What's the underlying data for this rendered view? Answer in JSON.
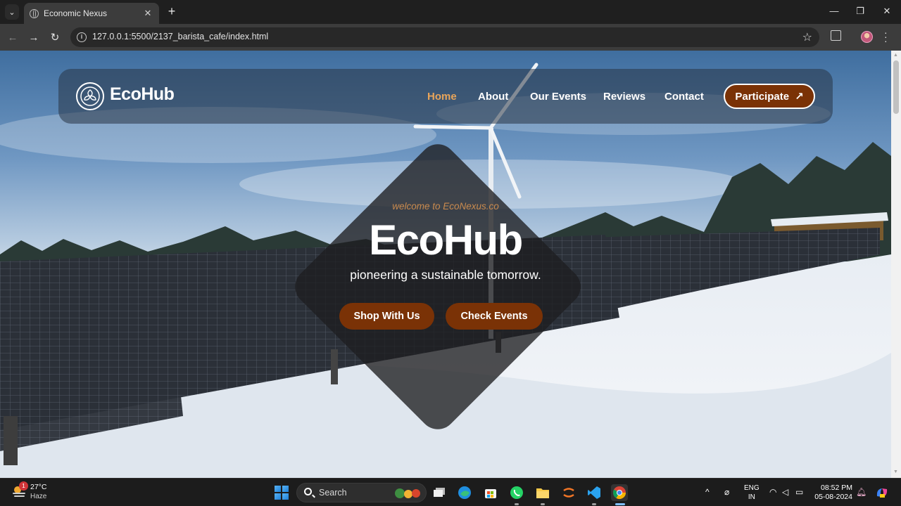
{
  "browser": {
    "tab_title": "Economic Nexus",
    "tab_close": "✕",
    "new_tab": "+",
    "url": "127.0.0.1:5500/2137_barista_cafe/index.html",
    "window_controls": {
      "minimize": "—",
      "maximize": "❐",
      "close": "✕"
    }
  },
  "navbar": {
    "brand": "EcoHub",
    "links": [
      {
        "label": "Home",
        "active": true
      },
      {
        "label": "About",
        "active": false
      },
      {
        "label": "Our Events",
        "active": false
      },
      {
        "label": "Reviews",
        "active": false
      },
      {
        "label": "Contact",
        "active": false
      }
    ],
    "cta_label": "Participate",
    "cta_arrow": "↗"
  },
  "hero": {
    "welcome": "welcome to EcoNexus.co",
    "title": "EcoHub",
    "tagline": "pioneering a sustainable tomorrow.",
    "primary_button": "Shop With Us",
    "secondary_button": "Check Events"
  },
  "taskbar": {
    "weather": {
      "temp": "27°C",
      "condition": "Haze",
      "badge": "1"
    },
    "search_placeholder": "Search",
    "lang_top": "ENG",
    "lang_bottom": "IN",
    "time": "08:52 PM",
    "date": "05-08-2024"
  },
  "colors": {
    "accent": "#7a3206",
    "active_link": "#e8a55a",
    "welcome_text": "#c98a4e"
  }
}
